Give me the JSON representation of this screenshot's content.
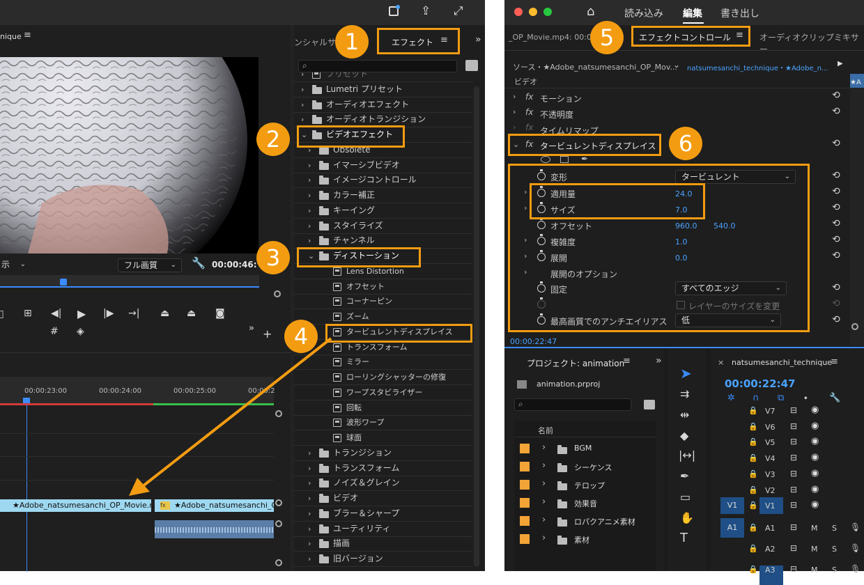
{
  "left": {
    "monitor_title": "nique",
    "effects_tab_partial": "ンシャルサ",
    "effects_tab": "エフェクト",
    "fit_label": "示",
    "quality": "フル画質",
    "timecode": "00:00:46:",
    "ruler": [
      "00:00:23:00",
      "00:00:24:00",
      "00:00:25:00",
      "00:00:2"
    ],
    "clip1": "★Adobe_natsumesanchi_OP_Movie.m",
    "clip2": "★Adobe_natsumesanchi_O",
    "effects_tree": {
      "top_partial": "プリセット",
      "lumetri": "Lumetri プリセット",
      "audio_effects": "オーディオエフェクト",
      "audio_transitions": "オーディオトランジション",
      "video_effects": "ビデオエフェクト",
      "video_children": [
        "Obsolete",
        "イマーシブビデオ",
        "イメージコントロール",
        "カラー補正",
        "キーイング",
        "スタイライズ",
        "チャンネル"
      ],
      "distortion": "ディストーション",
      "distortion_children": [
        "Lens Distortion",
        "オフセット",
        "コーナーピン",
        "ズーム",
        "タービュレントディスプレイス",
        "トランスフォーム",
        "ミラー",
        "ローリングシャッターの修復",
        "ワープスタビライザー",
        "回転",
        "波形ワープ",
        "球面"
      ],
      "after": [
        "トランジション",
        "トランスフォーム",
        "ノイズ＆グレイン",
        "ビデオ",
        "ブラー＆シャープ",
        "ユーティリティ",
        "描画",
        "旧バージョン"
      ]
    }
  },
  "right": {
    "top_tabs": [
      "読み込み",
      "編集",
      "書き出し"
    ],
    "active_tab": "編集",
    "panel_tab_partial": "_OP_Movie.mp4: 00:00:2",
    "effect_controls_tab": "エフェクトコントロール",
    "audio_mixer_tab": "オーディオクリップミキサー",
    "source_label": "ソース・★Adobe_natsumesanchi_OP_Mov...",
    "sequence_label": "natsumesanchi_technique・★Adobe_n...",
    "mini_label": "★A",
    "video_header": "ビデオ",
    "fx_motion": "モーション",
    "fx_opacity": "不透明度",
    "fx_timeremap": "タイムリマップ",
    "fx_turbulent": "タービュレントディスプレイス",
    "params": {
      "transform_label": "変形",
      "transform_value": "タービュレント",
      "amount_label": "適用量",
      "amount_value": "24.0",
      "size_label": "サイズ",
      "size_value": "7.0",
      "offset_label": "オフセット",
      "offset_x": "960.0",
      "offset_y": "540.0",
      "complexity_label": "複雑度",
      "complexity_value": "1.0",
      "evolution_label": "展開",
      "evolution_value": "0.0",
      "evolution_opts": "展開のオプション",
      "pin_label": "固定",
      "pin_value": "すべてのエッジ",
      "resize_label": "レイヤーのサイズを変更",
      "antialias_label": "最高画質でのアンチエイリアス",
      "antialias_value": "低"
    },
    "ec_timecode": "00:00:22:47",
    "project_tab": "プロジェクト: animation",
    "project_file": "animation.prproj",
    "project_col": "名前",
    "project_items": [
      "BGM",
      "シーケンス",
      "テロップ",
      "効果音",
      "ロパクアニメ素材",
      "素材"
    ],
    "seq_tab": "natsumesanchi_technique",
    "seq_timecode": "00:00:22:47",
    "video_tracks": [
      "V7",
      "V6",
      "V5",
      "V4",
      "V3",
      "V2",
      "V1"
    ],
    "audio_tracks": [
      "A1",
      "A2",
      "A3"
    ],
    "src_v1": "V1",
    "src_a1": "A1",
    "m_label": "M",
    "s_label": "S"
  },
  "badges": [
    "1",
    "2",
    "3",
    "4",
    "5",
    "6"
  ],
  "colors": {
    "accent": "#f39c11",
    "clip": "#9ed8f0",
    "blue_value": "#4aa3ff"
  }
}
